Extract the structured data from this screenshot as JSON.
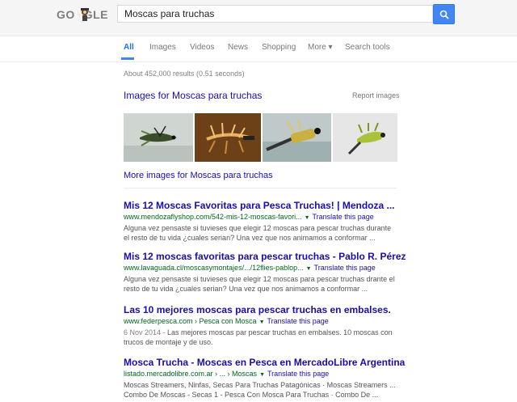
{
  "header": {
    "logo_text": "GOOGLE",
    "query": "Moscas para truchas",
    "search_icon": "search-icon"
  },
  "tabs": [
    {
      "label": "All",
      "active": true
    },
    {
      "label": "Images"
    },
    {
      "label": "Videos"
    },
    {
      "label": "News"
    },
    {
      "label": "Shopping"
    },
    {
      "label": "More ▾"
    },
    {
      "label": "Search tools"
    }
  ],
  "stats": "About 452,000 results (0.51 seconds)",
  "images": {
    "title": "Images for Moscas para truchas",
    "report": "Report images",
    "more": "More images for Moscas para truchas"
  },
  "results": [
    {
      "title": "Mis 12 Moscas Favoritas para Pesca Truchas! | Mendoza ...",
      "url": "www.mendozaflyshop.com/542-mis-12-moscas-favori...",
      "translate": "Translate this page",
      "snippet": "Alguna vez pensaste si tuvieses que elegir 12 moscas para pescar truchas durante el resto de tu vida ¿cuales serian? Una vez que nos animamos a conformar ..."
    },
    {
      "title": "Mis 12 moscas favoritas para pescar truchas - Pablo R. Pérez",
      "url": "www.lavaguada.cl/moscasymontajes/.../12flies-pablop...",
      "translate": "Translate this page",
      "snippet": "Alguna vez pensaste si tuvieses que elegir 12 moscas para pescar truchas drante el resto de tu vida ¿cuales serian? Una vez que nos animamos a conformar ..."
    },
    {
      "title": "Las 10 mejores moscas para pescar truchas en embalses.",
      "url": "www.federpesca.com › Pesca con Mosca",
      "translate": "Translate this page",
      "date": "6 Nov 2014 - ",
      "snippet": "Las mejores moscas par pescar truchas en embalses. 10 moscas con trucos de montaje y de uso."
    },
    {
      "title": "Mosca Trucha - Moscas en Pesca en MercadoLibre Argentina",
      "url": "listado.mercadolibre.com.ar › ... › Moscas",
      "translate": "Translate this page",
      "snippet": "Moscas Streamers, Ninfas, Secas Para Truchas Patagónicas · Moscas Streamers ... Combo De Moscas - Secas 1 - Pesca Con Mosca Para Truchas · Combo De ..."
    }
  ],
  "colors": {
    "link": "#1a0dab",
    "url": "#006621",
    "accent": "#4285f4"
  }
}
